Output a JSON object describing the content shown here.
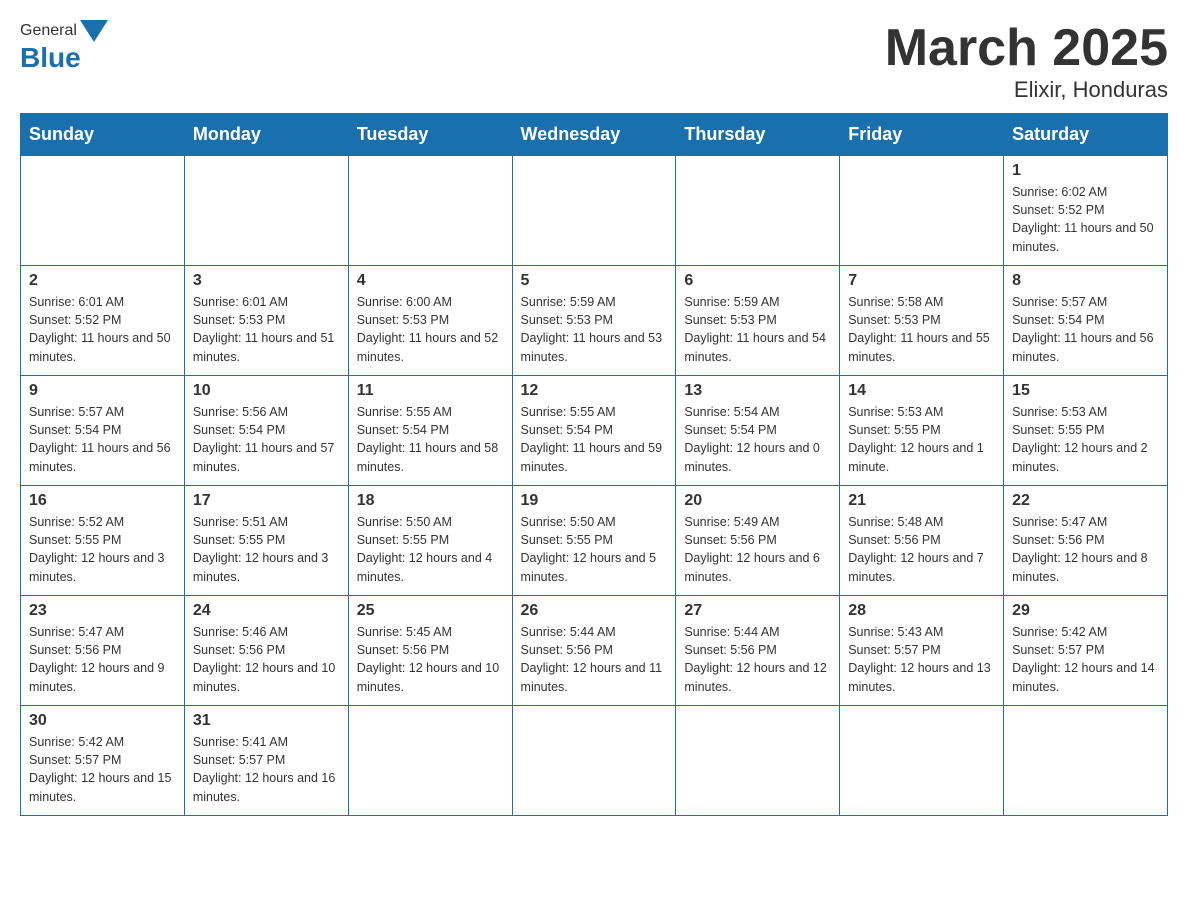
{
  "header": {
    "logo_general": "General",
    "logo_blue": "Blue",
    "month_title": "March 2025",
    "location": "Elixir, Honduras"
  },
  "weekdays": [
    "Sunday",
    "Monday",
    "Tuesday",
    "Wednesday",
    "Thursday",
    "Friday",
    "Saturday"
  ],
  "weeks": [
    [
      {
        "day": "",
        "info": ""
      },
      {
        "day": "",
        "info": ""
      },
      {
        "day": "",
        "info": ""
      },
      {
        "day": "",
        "info": ""
      },
      {
        "day": "",
        "info": ""
      },
      {
        "day": "",
        "info": ""
      },
      {
        "day": "1",
        "info": "Sunrise: 6:02 AM\nSunset: 5:52 PM\nDaylight: 11 hours and 50 minutes."
      }
    ],
    [
      {
        "day": "2",
        "info": "Sunrise: 6:01 AM\nSunset: 5:52 PM\nDaylight: 11 hours and 50 minutes."
      },
      {
        "day": "3",
        "info": "Sunrise: 6:01 AM\nSunset: 5:53 PM\nDaylight: 11 hours and 51 minutes."
      },
      {
        "day": "4",
        "info": "Sunrise: 6:00 AM\nSunset: 5:53 PM\nDaylight: 11 hours and 52 minutes."
      },
      {
        "day": "5",
        "info": "Sunrise: 5:59 AM\nSunset: 5:53 PM\nDaylight: 11 hours and 53 minutes."
      },
      {
        "day": "6",
        "info": "Sunrise: 5:59 AM\nSunset: 5:53 PM\nDaylight: 11 hours and 54 minutes."
      },
      {
        "day": "7",
        "info": "Sunrise: 5:58 AM\nSunset: 5:53 PM\nDaylight: 11 hours and 55 minutes."
      },
      {
        "day": "8",
        "info": "Sunrise: 5:57 AM\nSunset: 5:54 PM\nDaylight: 11 hours and 56 minutes."
      }
    ],
    [
      {
        "day": "9",
        "info": "Sunrise: 5:57 AM\nSunset: 5:54 PM\nDaylight: 11 hours and 56 minutes."
      },
      {
        "day": "10",
        "info": "Sunrise: 5:56 AM\nSunset: 5:54 PM\nDaylight: 11 hours and 57 minutes."
      },
      {
        "day": "11",
        "info": "Sunrise: 5:55 AM\nSunset: 5:54 PM\nDaylight: 11 hours and 58 minutes."
      },
      {
        "day": "12",
        "info": "Sunrise: 5:55 AM\nSunset: 5:54 PM\nDaylight: 11 hours and 59 minutes."
      },
      {
        "day": "13",
        "info": "Sunrise: 5:54 AM\nSunset: 5:54 PM\nDaylight: 12 hours and 0 minutes."
      },
      {
        "day": "14",
        "info": "Sunrise: 5:53 AM\nSunset: 5:55 PM\nDaylight: 12 hours and 1 minute."
      },
      {
        "day": "15",
        "info": "Sunrise: 5:53 AM\nSunset: 5:55 PM\nDaylight: 12 hours and 2 minutes."
      }
    ],
    [
      {
        "day": "16",
        "info": "Sunrise: 5:52 AM\nSunset: 5:55 PM\nDaylight: 12 hours and 3 minutes."
      },
      {
        "day": "17",
        "info": "Sunrise: 5:51 AM\nSunset: 5:55 PM\nDaylight: 12 hours and 3 minutes."
      },
      {
        "day": "18",
        "info": "Sunrise: 5:50 AM\nSunset: 5:55 PM\nDaylight: 12 hours and 4 minutes."
      },
      {
        "day": "19",
        "info": "Sunrise: 5:50 AM\nSunset: 5:55 PM\nDaylight: 12 hours and 5 minutes."
      },
      {
        "day": "20",
        "info": "Sunrise: 5:49 AM\nSunset: 5:56 PM\nDaylight: 12 hours and 6 minutes."
      },
      {
        "day": "21",
        "info": "Sunrise: 5:48 AM\nSunset: 5:56 PM\nDaylight: 12 hours and 7 minutes."
      },
      {
        "day": "22",
        "info": "Sunrise: 5:47 AM\nSunset: 5:56 PM\nDaylight: 12 hours and 8 minutes."
      }
    ],
    [
      {
        "day": "23",
        "info": "Sunrise: 5:47 AM\nSunset: 5:56 PM\nDaylight: 12 hours and 9 minutes."
      },
      {
        "day": "24",
        "info": "Sunrise: 5:46 AM\nSunset: 5:56 PM\nDaylight: 12 hours and 10 minutes."
      },
      {
        "day": "25",
        "info": "Sunrise: 5:45 AM\nSunset: 5:56 PM\nDaylight: 12 hours and 10 minutes."
      },
      {
        "day": "26",
        "info": "Sunrise: 5:44 AM\nSunset: 5:56 PM\nDaylight: 12 hours and 11 minutes."
      },
      {
        "day": "27",
        "info": "Sunrise: 5:44 AM\nSunset: 5:56 PM\nDaylight: 12 hours and 12 minutes."
      },
      {
        "day": "28",
        "info": "Sunrise: 5:43 AM\nSunset: 5:57 PM\nDaylight: 12 hours and 13 minutes."
      },
      {
        "day": "29",
        "info": "Sunrise: 5:42 AM\nSunset: 5:57 PM\nDaylight: 12 hours and 14 minutes."
      }
    ],
    [
      {
        "day": "30",
        "info": "Sunrise: 5:42 AM\nSunset: 5:57 PM\nDaylight: 12 hours and 15 minutes."
      },
      {
        "day": "31",
        "info": "Sunrise: 5:41 AM\nSunset: 5:57 PM\nDaylight: 12 hours and 16 minutes."
      },
      {
        "day": "",
        "info": ""
      },
      {
        "day": "",
        "info": ""
      },
      {
        "day": "",
        "info": ""
      },
      {
        "day": "",
        "info": ""
      },
      {
        "day": "",
        "info": ""
      }
    ]
  ]
}
